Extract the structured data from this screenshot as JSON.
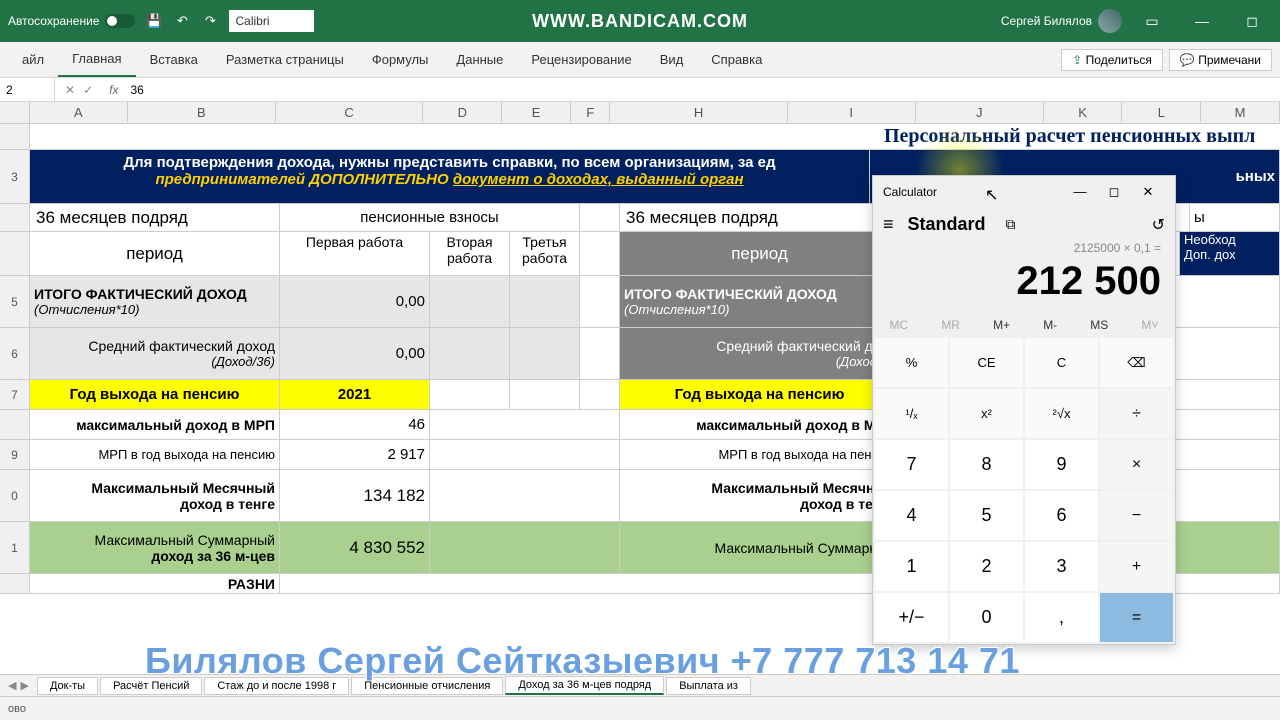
{
  "titlebar": {
    "autosave": "Автосохранение",
    "font": "Calibri",
    "bandicam": "WWW.BANDICAM.COM",
    "user": "Сергей Билялов"
  },
  "ribbon": {
    "tabs": [
      "айл",
      "Главная",
      "Вставка",
      "Разметка страницы",
      "Формулы",
      "Данные",
      "Рецензирование",
      "Вид",
      "Справка"
    ],
    "share": "Поделиться",
    "comments": "Примечани"
  },
  "formulaBar": {
    "name": "2",
    "value": "36"
  },
  "cols": [
    "A",
    "B",
    "C",
    "D",
    "E",
    "F",
    "H",
    "I",
    "J",
    "K",
    "L",
    "M"
  ],
  "worksheet": {
    "title_row": "Персональный расчет пенсионных выпл",
    "banner_line1": "Для подтверждения дохода, нужны представить справки, по всем организациям, за ед",
    "banner_line1_tail": "ьных",
    "banner_line2a": "предпринимателей ",
    "banner_line2b": "ДОПОЛНИТЕЛЬНО ",
    "banner_line2c": "документ о доходах, выданный орган",
    "h36_1": "36 месяцев подряд",
    "pension_contrib": "пенсионные взносы",
    "h36_2": "36 месяцев подряд",
    "hY": "ы",
    "period": "период",
    "work1": "Первая работа",
    "work2": "Вторая работа",
    "work3": "Третья работа",
    "period2": "период",
    "need": "Необход",
    "dop": "Доп. дох",
    "r5a": "ИТОГО ФАКТИЧЕСКИЙ ДОХОД",
    "r5b": "(Отчисления*10)",
    "r5val": "0,00",
    "r5a2": "ИТОГО ФАКТИЧЕСКИЙ ДОХОД",
    "r5b2": "(Отчисления*10)",
    "r6a": "Средний фактический доход",
    "r6b": "(Доход/36)",
    "r6val": "0,00",
    "r6a2": "Средний фактический дохо",
    "r6b2": "(Доход/36",
    "r7a": "Год выхода на пенсию",
    "r7val": "2021",
    "r7a2": "Год выхода на пенсию",
    "r8a": "максимальный доход в МРП",
    "r8val": "46",
    "r8a2": "максимальный доход в МРП",
    "r9a": "МРП в год выхода на пенсию",
    "r9val": "2 917",
    "r9a2": "МРП в год выхода на пенсию",
    "r10a": "Максимальный Месячный",
    "r10b": "доход в тенге",
    "r10val": "134 182",
    "r10a2": "Максимальный Месячный",
    "r10b2": "доход в тенге",
    "r11a": "Максимальный Суммарный",
    "r11b": "доход за 36 м-цев",
    "r11val": "4 830 552",
    "r11a2": "Максимальный Суммарный",
    "r12a": "РАЗНИ"
  },
  "sheetTabs": [
    "Док-ты",
    "Расчёт Пенсий",
    "Стаж до и после 1998 г",
    "Пенсионные отчисления",
    "Доход за 36 м-цев подряд",
    "Выплата из"
  ],
  "activeTab": 4,
  "status": "ово",
  "calc": {
    "title": "Calculator",
    "mode": "Standard",
    "expr": "2125000 × 0,1 =",
    "result": "212 500",
    "mem": [
      "MC",
      "MR",
      "M+",
      "M-",
      "MS",
      "M˅"
    ],
    "grid": [
      "%",
      "CE",
      "C",
      "⌫",
      "¹/ₓ",
      "x²",
      "²√x",
      "÷",
      "7",
      "8",
      "9",
      "×",
      "4",
      "5",
      "6",
      "−",
      "1",
      "2",
      "3",
      "+",
      "+/−",
      "0",
      ",",
      "="
    ]
  },
  "watermark": "Билялов Сергей Сейтказыевич +7 777 713 14 71"
}
